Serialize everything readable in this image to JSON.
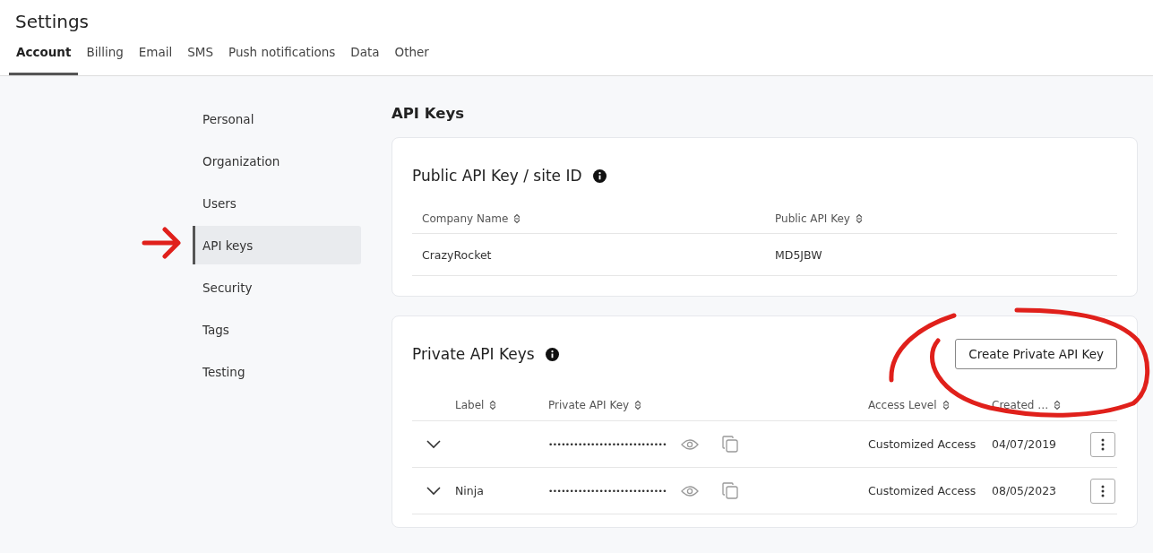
{
  "title": "Settings",
  "tabs": [
    {
      "label": "Account",
      "selected": true
    },
    {
      "label": "Billing",
      "selected": false
    },
    {
      "label": "Email",
      "selected": false
    },
    {
      "label": "SMS",
      "selected": false
    },
    {
      "label": "Push notifications",
      "selected": false
    },
    {
      "label": "Data",
      "selected": false
    },
    {
      "label": "Other",
      "selected": false
    }
  ],
  "sidebar": {
    "items": [
      {
        "label": "Personal",
        "selected": false
      },
      {
        "label": "Organization",
        "selected": false
      },
      {
        "label": "Users",
        "selected": false
      },
      {
        "label": "API keys",
        "selected": true
      },
      {
        "label": "Security",
        "selected": false
      },
      {
        "label": "Tags",
        "selected": false
      },
      {
        "label": "Testing",
        "selected": false
      }
    ]
  },
  "heading": "API Keys",
  "public_card": {
    "title": "Public API Key / site ID",
    "columns": [
      "Company Name",
      "Public API Key"
    ],
    "rows": [
      [
        "CrazyRocket",
        "MD5JBW"
      ]
    ]
  },
  "private_card": {
    "title": "Private API Keys",
    "button": "Create Private API Key",
    "columns": [
      "Label",
      "Private API Key",
      "Access Level",
      "Created …"
    ],
    "rows": [
      {
        "label": "",
        "key": "••••••••••••••••••••••••••••",
        "access": "Customized Access",
        "created": "04/07/2019",
        "expanded": false
      },
      {
        "label": "Ninja",
        "key": "••••••••••••••••••••••••••••",
        "access": "Customized Access",
        "created": "08/05/2023",
        "expanded": false
      }
    ]
  }
}
